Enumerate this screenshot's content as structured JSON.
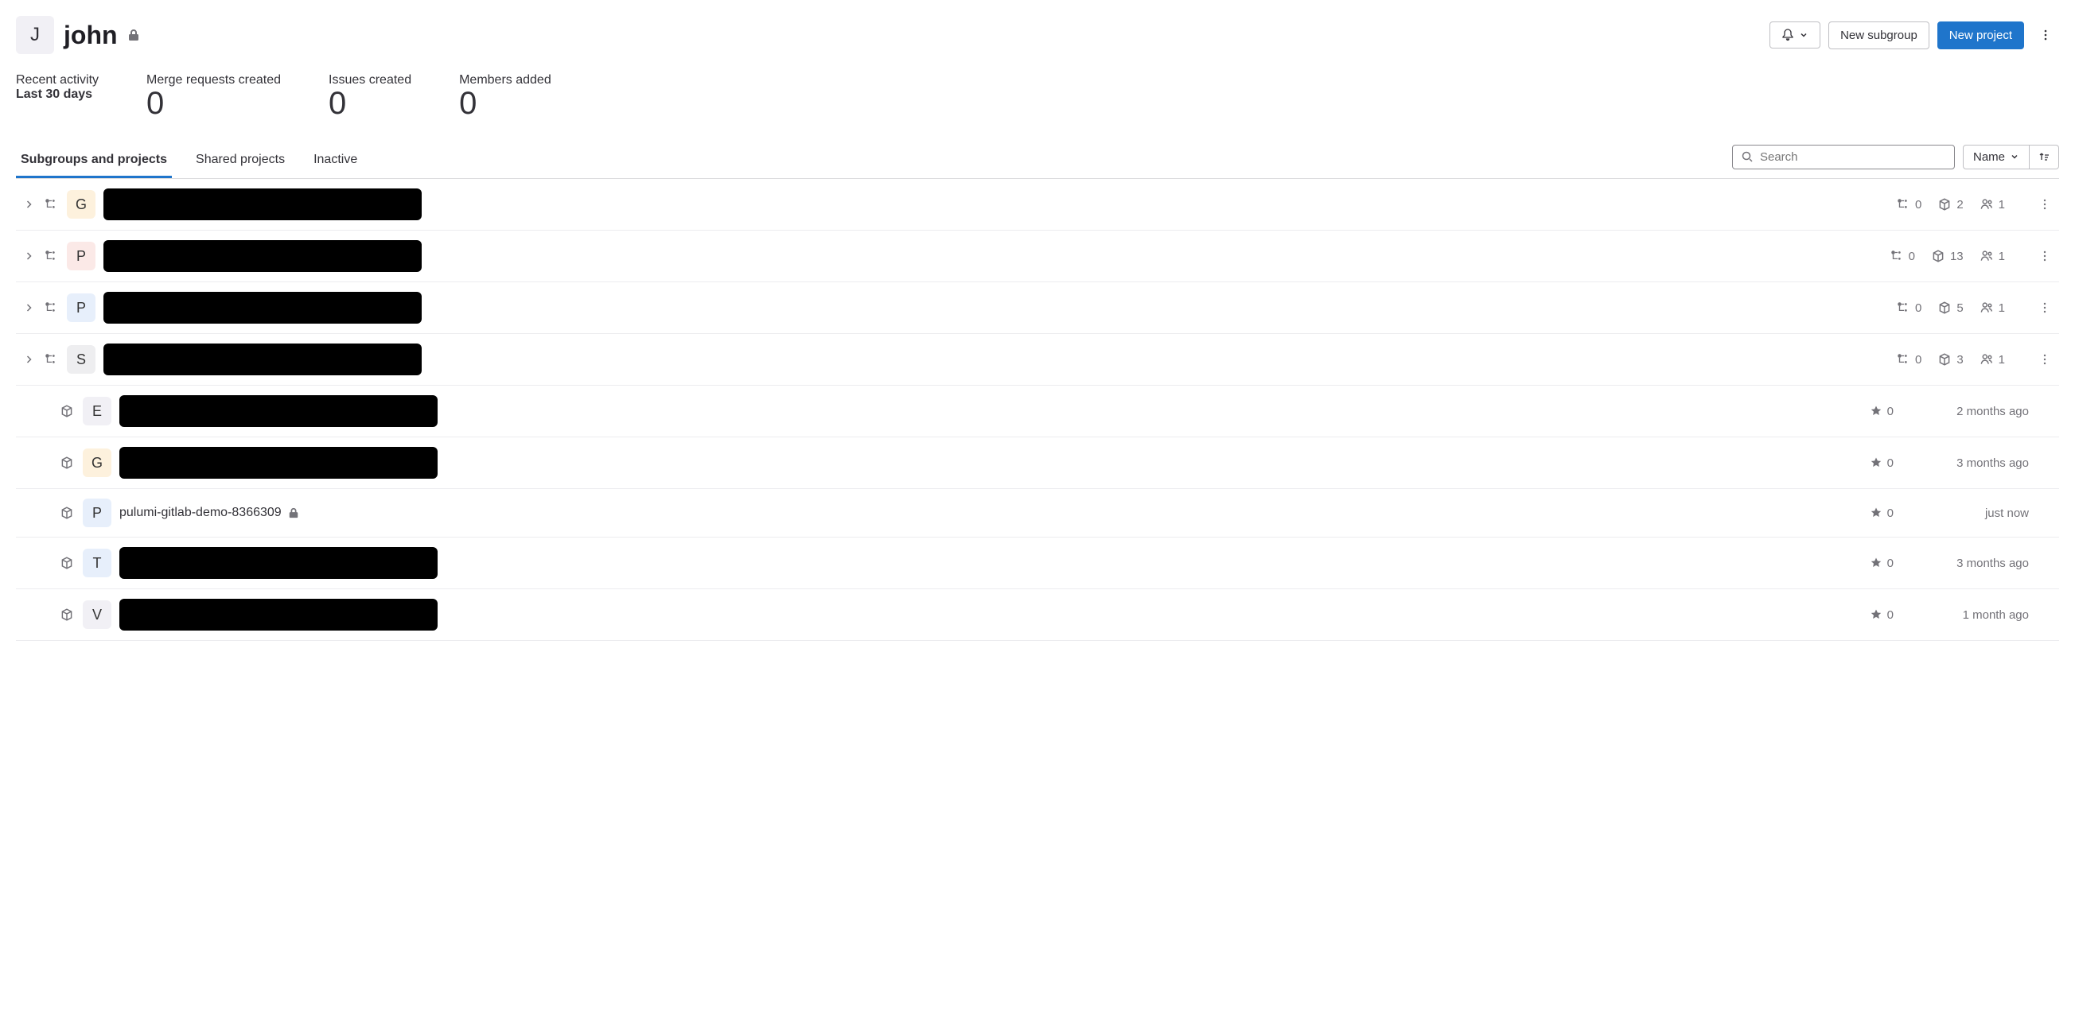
{
  "header": {
    "avatar_letter": "J",
    "title": "john",
    "new_subgroup": "New subgroup",
    "new_project": "New project"
  },
  "stats": {
    "recent_label": "Recent activity",
    "recent_sub": "Last 30 days",
    "mr_label": "Merge requests created",
    "mr_value": "0",
    "issues_label": "Issues created",
    "issues_value": "0",
    "members_label": "Members added",
    "members_value": "0"
  },
  "tabs": {
    "subgroups": "Subgroups and projects",
    "shared": "Shared projects",
    "inactive": "Inactive"
  },
  "controls": {
    "search_placeholder": "Search",
    "sort_label": "Name"
  },
  "rows": [
    {
      "type": "group",
      "letter": "G",
      "avatar": "beige",
      "redacted": true,
      "sub": "0",
      "proj": "2",
      "mem": "1"
    },
    {
      "type": "group",
      "letter": "P",
      "avatar": "pink",
      "redacted": true,
      "sub": "0",
      "proj": "13",
      "mem": "1"
    },
    {
      "type": "group",
      "letter": "P",
      "avatar": "blue",
      "redacted": true,
      "sub": "0",
      "proj": "5",
      "mem": "1"
    },
    {
      "type": "group",
      "letter": "S",
      "avatar": "gray",
      "redacted": true,
      "sub": "0",
      "proj": "3",
      "mem": "1"
    },
    {
      "type": "project",
      "letter": "E",
      "avatar": "ltgray",
      "redacted": true,
      "stars": "0",
      "updated": "2 months ago"
    },
    {
      "type": "project",
      "letter": "G",
      "avatar": "beige",
      "redacted": true,
      "stars": "0",
      "updated": "3 months ago"
    },
    {
      "type": "project",
      "letter": "P",
      "avatar": "blue",
      "redacted": false,
      "name": "pulumi-gitlab-demo-8366309",
      "stars": "0",
      "updated": "just now",
      "locked": true
    },
    {
      "type": "project",
      "letter": "T",
      "avatar": "blue",
      "redacted": true,
      "stars": "0",
      "updated": "3 months ago"
    },
    {
      "type": "project",
      "letter": "V",
      "avatar": "ltgray",
      "redacted": true,
      "stars": "0",
      "updated": "1 month ago"
    }
  ]
}
